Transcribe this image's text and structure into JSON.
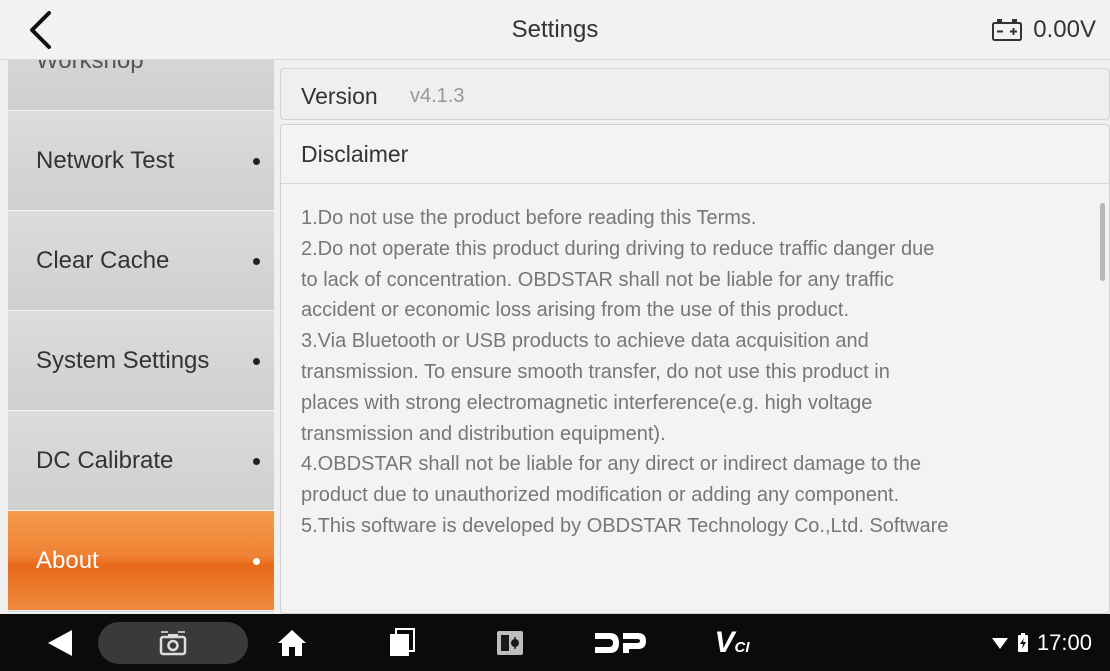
{
  "header": {
    "title": "Settings",
    "voltage": "0.00V",
    "back_icon": "chevron-left-icon",
    "battery_icon": "car-battery-icon"
  },
  "sidebar": {
    "items": [
      {
        "label": "Workshop",
        "partial": true
      },
      {
        "label": "Network Test"
      },
      {
        "label": "Clear Cache"
      },
      {
        "label": "System Settings"
      },
      {
        "label": "DC Calibrate"
      },
      {
        "label": "About",
        "active": true
      }
    ],
    "active_color": "#f08235"
  },
  "content": {
    "version_label": "Version",
    "version_value": "v4.1.3",
    "disclaimer_title": "Disclaimer",
    "disclaimer_lines": [
      "1.Do not use the product before reading this Terms.",
      "2.Do not operate this product during driving to reduce traffic danger due",
      "to lack of concentration. OBDSTAR shall not be liable for any traffic",
      "accident or economic loss arising from the use of this product.",
      "3.Via Bluetooth or USB products to achieve data acquisition and",
      "transmission. To ensure smooth transfer, do not use this product in",
      "places with strong electromagnetic interference(e.g. high voltage",
      "transmission and distribution equipment).",
      "4.OBDSTAR shall not be liable for any direct or indirect damage to the",
      "product due to unauthorized modification or adding any component.",
      "5.This software is developed by OBDSTAR Technology Co.,Ltd. Software"
    ]
  },
  "navbar": {
    "icons": [
      "back-triangle-icon",
      "screenshot-camera-icon",
      "home-icon",
      "recents-icon",
      "vci-manager-icon",
      "dp-icon",
      "vci-icon"
    ],
    "vci_text": "V",
    "vci_sub": "CI",
    "dp_text": "DP",
    "time": "17:00"
  }
}
